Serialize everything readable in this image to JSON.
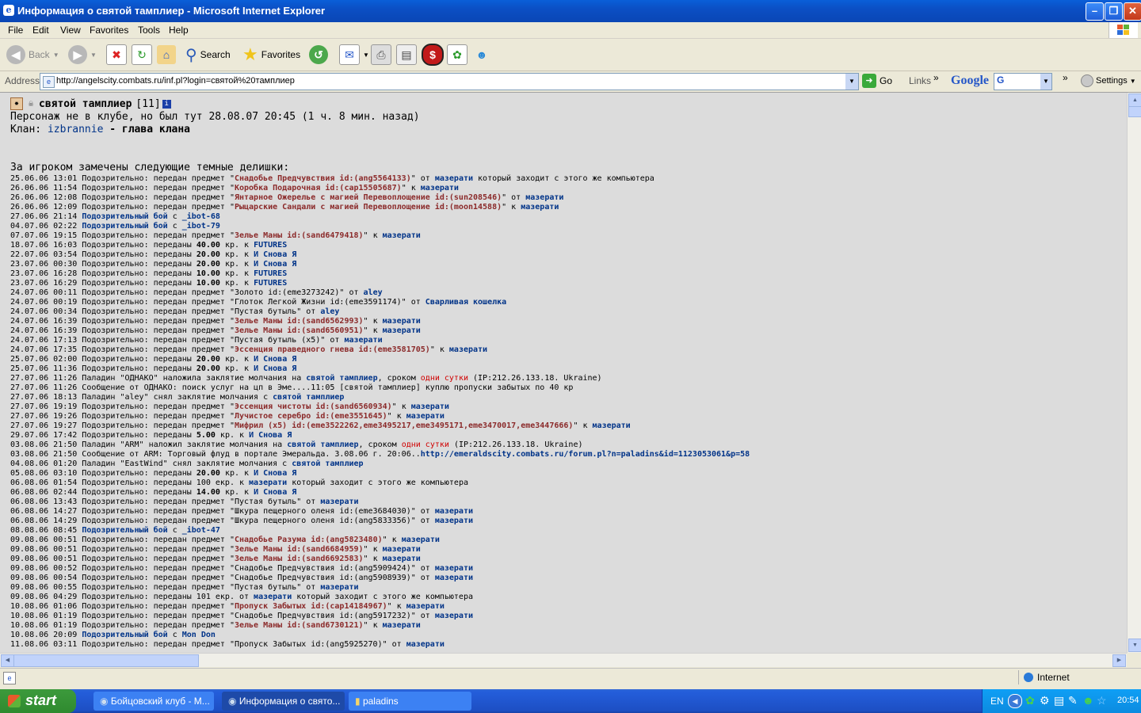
{
  "window": {
    "title": "Информация о святой тамплиер - Microsoft Internet Explorer"
  },
  "menu": [
    "File",
    "Edit",
    "View",
    "Favorites",
    "Tools",
    "Help"
  ],
  "toolbar": {
    "back": "Back",
    "search": "Search",
    "favorites": "Favorites"
  },
  "address": {
    "label": "Address",
    "url": "http://angelscity.combats.ru/inf.pl?login=святой%20тамплиер",
    "go": "Go",
    "links": "Links",
    "google": "Google",
    "settings": "Settings"
  },
  "profile": {
    "name": "святой тамплиер",
    "level": "[11]",
    "status_line": "Персонаж не в клубе, но был тут 28.08.07 20:45 (1 ч. 8 мин. назад)",
    "clan_label": "Клан:",
    "clan_name": "izbrannie",
    "clan_role": " - глава клана",
    "section_title": "За игроком замечены следующие темные делишки:"
  },
  "log": [
    {
      "t": "25.06.06 13:01 Подозрительно: передан предмет \"",
      "item": "Снадобье Предчувствия id:(ang5564133)",
      "m": "\" от ",
      "nick": "мазерати",
      "tail": " который заходит с этого же компьютера"
    },
    {
      "t": "26.06.06 11:54 Подозрительно: передан предмет \"",
      "item": "Коробка Подарочная id:(cap15505687)",
      "m": "\" к ",
      "nick": "мазерати",
      "tail": ""
    },
    {
      "t": "26.06.06 12:08 Подозрительно: передан предмет \"",
      "item": "Янтарное Ожерелье с магией Перевоплощение id:(sun208546)",
      "m": "\" от ",
      "nick": "мазерати",
      "tail": ""
    },
    {
      "t": "26.06.06 12:09 Подозрительно: передан предмет \"",
      "item": "Рыцарские Сандали с магией Перевоплощение id:(moon14588)",
      "m": "\" к ",
      "nick": "мазерати",
      "tail": ""
    },
    {
      "t": "27.06.06 21:14 ",
      "item": "",
      "m": "",
      "nick": "Подозрительный бой",
      "tail": " с ",
      "nick2": "_ibot-68"
    },
    {
      "t": "04.07.06 02:22 ",
      "item": "",
      "m": "",
      "nick": "Подозрительный бой",
      "tail": " с ",
      "nick2": "_ibot-79"
    },
    {
      "t": "07.07.06 19:15 Подозрительно: передан предмет \"",
      "item": "Зелье Маны id:(sand6479418)",
      "m": "\" к ",
      "nick": "мазерати",
      "tail": ""
    },
    {
      "t": "18.07.06 16:03 Подозрительно: переданы ",
      "num": "40.00",
      "m": " кр. к ",
      "nick": "FUTURES",
      "tail": ""
    },
    {
      "t": "22.07.06 03:54 Подозрительно: переданы ",
      "num": "20.00",
      "m": " кр. к ",
      "nick": "И Снова Я",
      "tail": ""
    },
    {
      "t": "23.07.06 00:30 Подозрительно: переданы ",
      "num": "20.00",
      "m": " кр. к ",
      "nick": "И Снова Я",
      "tail": ""
    },
    {
      "t": "23.07.06 16:28 Подозрительно: переданы ",
      "num": "10.00",
      "m": " кр. к ",
      "nick": "FUTURES",
      "tail": ""
    },
    {
      "t": "23.07.06 16:29 Подозрительно: переданы ",
      "num": "10.00",
      "m": " кр. к ",
      "nick": "FUTURES",
      "tail": ""
    },
    {
      "t": "24.07.06 00:11 Подозрительно: передан предмет \"Золото id:(eme3273242)\" от ",
      "item": "",
      "m": "",
      "nick": "aley",
      "tail": ""
    },
    {
      "t": "24.07.06 00:19 Подозрительно: передан предмет \"Глоток Легкой Жизни id:(eme3591174)\" от ",
      "item": "",
      "m": "",
      "nick": "Сварливая кошелка",
      "tail": ""
    },
    {
      "t": "24.07.06 00:34 Подозрительно: передан предмет \"Пустая бутыль\" от ",
      "item": "",
      "m": "",
      "nick": "aley",
      "tail": ""
    },
    {
      "t": "24.07.06 16:39 Подозрительно: передан предмет \"",
      "item": "Зелье Маны id:(sand6562993)",
      "m": "\" к ",
      "nick": "мазерати",
      "tail": ""
    },
    {
      "t": "24.07.06 16:39 Подозрительно: передан предмет \"",
      "item": "Зелье Маны id:(sand6560951)",
      "m": "\" к ",
      "nick": "мазерати",
      "tail": ""
    },
    {
      "t": "24.07.06 17:13 Подозрительно: передан предмет \"Пустая бутыль (x5)\" от ",
      "item": "",
      "m": "",
      "nick": "мазерати",
      "tail": ""
    },
    {
      "t": "24.07.06 17:35 Подозрительно: передан предмет \"",
      "item": "Эссенция праведного гнева id:(eme3581705)",
      "m": "\" к ",
      "nick": "мазерати",
      "tail": ""
    },
    {
      "t": "25.07.06 02:00 Подозрительно: переданы ",
      "num": "20.00",
      "m": " кр. к ",
      "nick": "И Снова Я",
      "tail": ""
    },
    {
      "t": "25.07.06 11:36 Подозрительно: переданы ",
      "num": "20.00",
      "m": " кр. к ",
      "nick": "И Снова Я",
      "tail": ""
    },
    {
      "t": "27.07.06 11:26 Паладин \"ОДНАКО\" наложила заклятие молчания на ",
      "item": "",
      "m": "",
      "nick": "святой тамплиер",
      "tail": ", сроком ",
      "red": "одни сутки",
      "tail2": " (IP:212.26.133.18. Ukraine)"
    },
    {
      "t": "27.07.06 11:26 Сообщение от ОДНАКО: поиск услуг на цп в Эме....11:05 [святой тамплиер] куплю пропуски забытых по 40 кр",
      "item": "",
      "m": "",
      "nick": "",
      "tail": ""
    },
    {
      "t": "27.07.06 18:13 Паладин \"aley\" снял заклятие молчания с ",
      "item": "",
      "m": "",
      "nick": "святой тамплиер",
      "tail": ""
    },
    {
      "t": "27.07.06 19:19 Подозрительно: передан предмет \"",
      "item": "Эссенция чистоты id:(sand6560934)",
      "m": "\" к ",
      "nick": "мазерати",
      "tail": ""
    },
    {
      "t": "27.07.06 19:26 Подозрительно: передан предмет \"",
      "item": "Лучистое серебро id:(eme3551645)",
      "m": "\" к ",
      "nick": "мазерати",
      "tail": ""
    },
    {
      "t": "27.07.06 19:27 Подозрительно: передан предмет \"",
      "item": "Мифрил (x5) id:(eme3522262,eme3495217,eme3495171,eme3470017,eme3447666)",
      "m": "\" к ",
      "nick": "мазерати",
      "tail": ""
    },
    {
      "t": "29.07.06 17:42 Подозрительно: переданы ",
      "num": "5.00",
      "m": " кр. к ",
      "nick": "И Снова Я",
      "tail": ""
    },
    {
      "t": "03.08.06 21:50 Паладин \"ARM\" наложил заклятие молчания на ",
      "item": "",
      "m": "",
      "nick": "святой тамплиер",
      "tail": ", сроком ",
      "red": "одни сутки",
      "tail2": " (IP:212.26.133.18. Ukraine)"
    },
    {
      "t": "03.08.06 21:50 Сообщение от ARM: Торговый флуд в портале Эмеральда. 3.08.06 г. 20:06..",
      "item": "",
      "m": "",
      "nick": "http://emeraldscity.combats.ru/forum.pl?n=paladins&id=1123053061&p=58",
      "tail": ""
    },
    {
      "t": "04.08.06 01:20 Паладин \"EastWind\" снял заклятие молчания с ",
      "item": "",
      "m": "",
      "nick": "святой тамплиер",
      "tail": ""
    },
    {
      "t": "05.08.06 03:10 Подозрительно: переданы ",
      "num": "20.00",
      "m": " кр. к ",
      "nick": "И Снова Я",
      "tail": ""
    },
    {
      "t": "06.08.06 01:54 Подозрительно: переданы 100 екр. к ",
      "item": "",
      "m": "",
      "nick": "мазерати",
      "tail": " который заходит с этого же компьютера"
    },
    {
      "t": "06.08.06 02:44 Подозрительно: переданы ",
      "num": "14.00",
      "m": " кр. к ",
      "nick": "И Снова Я",
      "tail": ""
    },
    {
      "t": "06.08.06 13:43 Подозрительно: передан предмет \"Пустая бутыль\" от ",
      "item": "",
      "m": "",
      "nick": "мазерати",
      "tail": ""
    },
    {
      "t": "06.08.06 14:27 Подозрительно: передан предмет \"Шкура пещерного оленя id:(eme3684030)\" от ",
      "item": "",
      "m": "",
      "nick": "мазерати",
      "tail": ""
    },
    {
      "t": "06.08.06 14:29 Подозрительно: передан предмет \"Шкура пещерного оленя id:(ang5833356)\" от ",
      "item": "",
      "m": "",
      "nick": "мазерати",
      "tail": ""
    },
    {
      "t": "08.08.06 08:45 ",
      "item": "",
      "m": "",
      "nick": "Подозрительный бой",
      "tail": " с ",
      "nick2": "_ibot-47"
    },
    {
      "t": "09.08.06 00:51 Подозрительно: передан предмет \"",
      "item": "Снадобье Разума id:(ang5823480)",
      "m": "\" к ",
      "nick": "мазерати",
      "tail": ""
    },
    {
      "t": "09.08.06 00:51 Подозрительно: передан предмет \"",
      "item": "Зелье Маны id:(sand6684959)",
      "m": "\" к ",
      "nick": "мазерати",
      "tail": ""
    },
    {
      "t": "09.08.06 00:51 Подозрительно: передан предмет \"",
      "item": "Зелье Маны id:(sand6692583)",
      "m": "\" к ",
      "nick": "мазерати",
      "tail": ""
    },
    {
      "t": "09.08.06 00:52 Подозрительно: передан предмет \"Снадобье Предчувствия id:(ang5909424)\" от ",
      "item": "",
      "m": "",
      "nick": "мазерати",
      "tail": ""
    },
    {
      "t": "09.08.06 00:54 Подозрительно: передан предмет \"Снадобье Предчувствия id:(ang5908939)\" от ",
      "item": "",
      "m": "",
      "nick": "мазерати",
      "tail": ""
    },
    {
      "t": "09.08.06 00:55 Подозрительно: передан предмет \"Пустая бутыль\" от ",
      "item": "",
      "m": "",
      "nick": "мазерати",
      "tail": ""
    },
    {
      "t": "09.08.06 04:29 Подозрительно: переданы 101 екр. от ",
      "item": "",
      "m": "",
      "nick": "мазерати",
      "tail": " который заходит с этого же компьютера"
    },
    {
      "t": "10.08.06 01:06 Подозрительно: передан предмет \"",
      "item": "Пропуск Забытых id:(cap14184967)",
      "m": "\" к ",
      "nick": "мазерати",
      "tail": ""
    },
    {
      "t": "10.08.06 01:19 Подозрительно: передан предмет \"Снадобье Предчувствия id:(ang5917232)\" от ",
      "item": "",
      "m": "",
      "nick": "мазерати",
      "tail": ""
    },
    {
      "t": "10.08.06 01:19 Подозрительно: передан предмет \"",
      "item": "Зелье Маны id:(sand6730121)",
      "m": "\" к ",
      "nick": "мазерати",
      "tail": ""
    },
    {
      "t": "10.08.06 20:09 ",
      "item": "",
      "m": "",
      "nick": "Подозрительный бой",
      "tail": " с ",
      "nick2": "Mon Don"
    },
    {
      "t": "11.08.06 03:11 Подозрительно: передан предмет \"Пропуск Забытых id:(ang5925270)\" от ",
      "item": "",
      "m": "",
      "nick": "мазерати",
      "tail": ""
    }
  ],
  "status": {
    "zone": "Internet"
  },
  "taskbar": {
    "start": "start",
    "tasks": [
      "Бойцовский клуб - M...",
      "Информация о свято...",
      "paladins"
    ],
    "lang": "EN",
    "clock": "20:54"
  }
}
